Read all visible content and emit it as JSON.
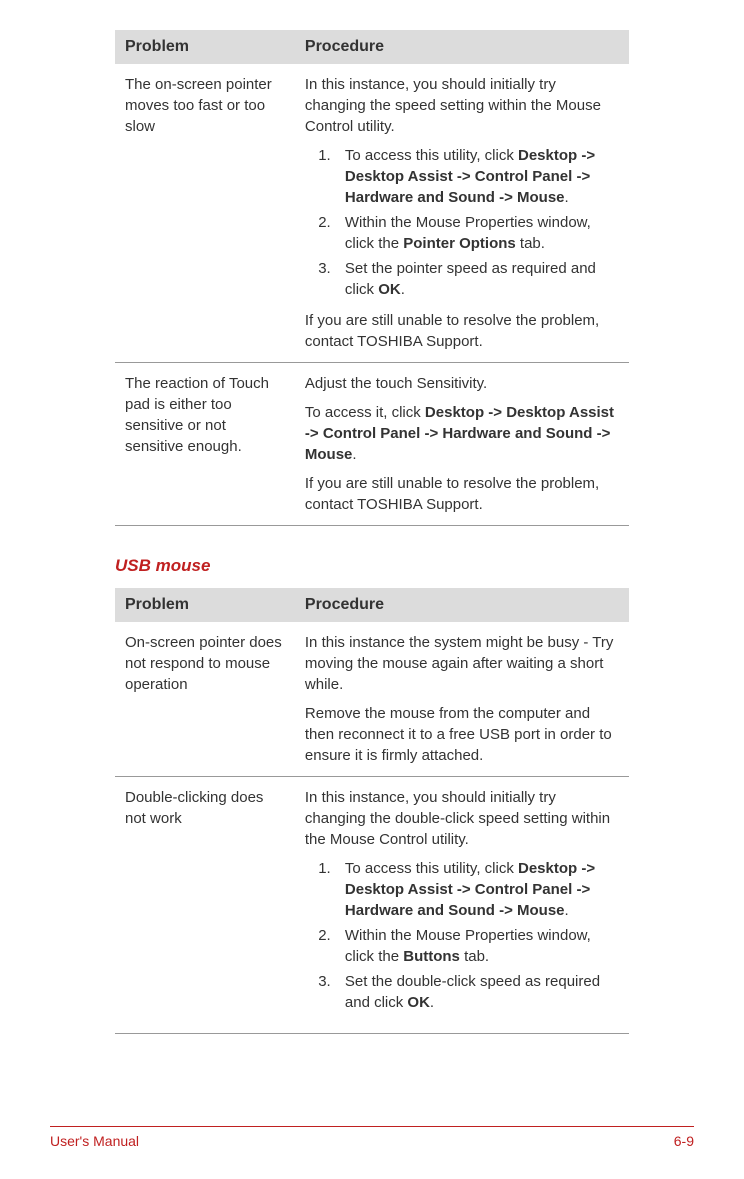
{
  "table1": {
    "header": {
      "col1": "Problem",
      "col2": "Procedure"
    },
    "rows": [
      {
        "problem": "The on-screen pointer moves too fast or too slow",
        "intro": "In this instance, you should initially try changing the speed setting within the Mouse Control utility.",
        "steps": [
          {
            "pre": "To access this utility, click ",
            "bold": "Desktop -> Desktop Assist -> Control Panel -> Hardware and Sound -> Mouse",
            "post": "."
          },
          {
            "pre": "Within the Mouse Properties window, click the ",
            "bold": "Pointer Options",
            "post": " tab."
          },
          {
            "pre": "Set the pointer speed as required and click ",
            "bold": "OK",
            "post": "."
          }
        ],
        "outro": "If you are still unable to resolve the problem, contact TOSHIBA Support."
      },
      {
        "problem": "The reaction of Touch pad is either too sensitive or not sensitive enough.",
        "p1": "Adjust the touch Sensitivity.",
        "p2_pre": "To access it, click ",
        "p2_bold": "Desktop -> Desktop Assist -> Control Panel -> Hardware and Sound -> Mouse",
        "p2_post": ".",
        "p3": "If you are still unable to resolve the problem, contact TOSHIBA Support."
      }
    ]
  },
  "section2_heading": "USB mouse",
  "table2": {
    "header": {
      "col1": "Problem",
      "col2": "Procedure"
    },
    "rows": [
      {
        "problem": "On-screen pointer does not respond to mouse operation",
        "p1": "In this instance the system might be busy - Try moving the mouse again after waiting a short while.",
        "p2": "Remove the mouse from the computer and then reconnect it to a free USB port in order to ensure it is firmly attached."
      },
      {
        "problem": "Double-clicking does not work",
        "intro": "In this instance, you should initially try changing the double-click speed setting within the Mouse Control utility.",
        "steps": [
          {
            "pre": "To access this utility, click ",
            "bold": "Desktop -> Desktop Assist -> Control Panel -> Hardware and Sound -> Mouse",
            "post": "."
          },
          {
            "pre": "Within the Mouse Properties window, click the ",
            "bold": "Buttons",
            "post": " tab."
          },
          {
            "pre": "Set the double-click speed as required and click ",
            "bold": "OK",
            "post": "."
          }
        ]
      }
    ]
  },
  "footer": {
    "left": "User's Manual",
    "right": "6-9"
  }
}
